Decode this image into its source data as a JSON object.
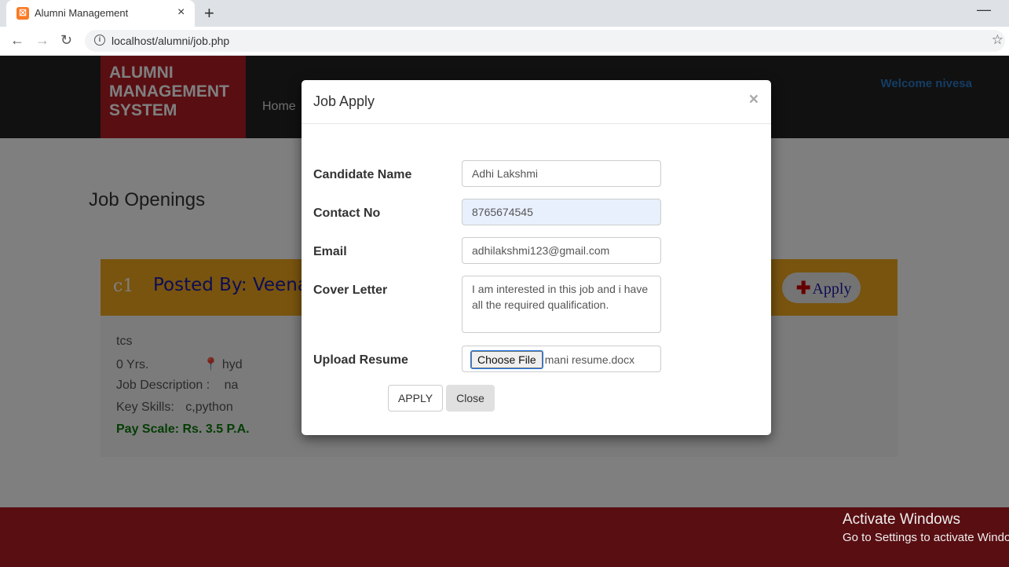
{
  "browser": {
    "tab_title": "Alumni Management",
    "tab_favicon": "xampp",
    "tab_close": "×",
    "new_tab": "+",
    "url": "localhost/alumni/job.php",
    "minimize": "—"
  },
  "site": {
    "brand_lines": [
      "ALUMNI",
      "MANAGEMENT",
      "SYSTEM"
    ],
    "nav_home": "Home",
    "welcome": "Welcome nivesa"
  },
  "jobs": {
    "heading": "Job Openings",
    "item": {
      "code": "c1",
      "posted_by": "Posted By: Veena",
      "apply_label": "Apply",
      "company": "tcs",
      "experience": "0 Yrs.",
      "location": "hyd",
      "description_label": "Job Description :",
      "description": "na",
      "skills_label": "Key Skills:",
      "skills": "c,python",
      "pay_scale": "Pay Scale: Rs. 3.5 P.A."
    }
  },
  "modal": {
    "title": "Job Apply",
    "close_symbol": "×",
    "fields": {
      "name_label": "Candidate Name",
      "name_value": "Adhi Lakshmi",
      "contact_label": "Contact No",
      "contact_value": "8765674545",
      "email_label": "Email",
      "email_value": "adhilakshmi123@gmail.com",
      "cover_label": "Cover Letter",
      "cover_value": "I am interested in this job and i have all the required qualification.",
      "resume_label": "Upload Resume",
      "resume_button": "Choose File",
      "resume_file": "mani  resume.docx"
    },
    "apply_button": "APPLY",
    "close_button": "Close"
  },
  "watermark": {
    "line1": "Activate Windows",
    "line2": "Go to Settings to activate Windows."
  },
  "colors": {
    "brand_red": "#b31c24",
    "navbar": "#222222",
    "banner": "#f2a81f",
    "welcome_blue": "#2a7ac8",
    "pay_green": "#087a08"
  }
}
